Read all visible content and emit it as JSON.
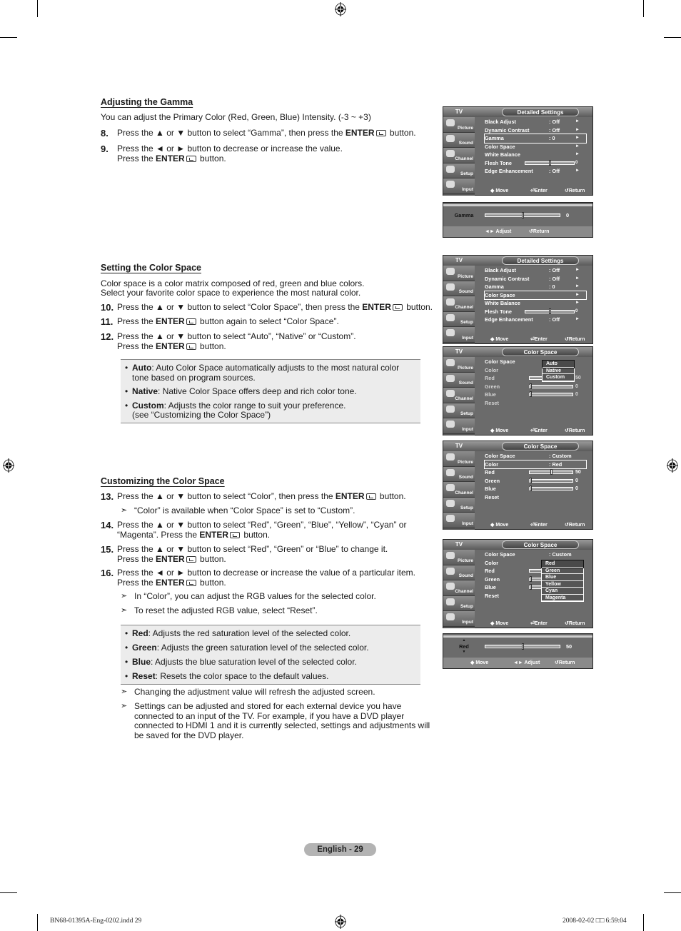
{
  "section_gamma": {
    "heading": "Adjusting the Gamma",
    "intro": "You can adjust the Primary Color (Red, Green, Blue) Intensity. (-3 ~ +3)",
    "steps": [
      {
        "num": "8.",
        "pre": "Press the ▲ or ▼ button to select “Gamma”, then press the ",
        "bold": "ENTER",
        "post": " button."
      },
      {
        "num": "9.",
        "pre": "Press the ◄ or ► button to decrease or increase the value.\nPress the ",
        "bold": "ENTER",
        "post": " button."
      }
    ]
  },
  "section_colorspace": {
    "heading": "Setting the Color Space",
    "intro": "Color space is a color matrix composed of red, green and blue colors.\nSelect your favorite color space to experience the most natural color.",
    "steps": [
      {
        "num": "10.",
        "pre": "Press the ▲ or ▼ button to select “Color Space”, then press the ",
        "bold": "ENTER",
        "post": " button."
      },
      {
        "num": "11.",
        "pre": "Press the ",
        "bold": "ENTER",
        "post": " button again to select “Color Space”."
      },
      {
        "num": "12.",
        "pre": "Press the ▲ or ▼ button to select “Auto”, “Native” or “Custom”.\nPress the ",
        "bold": "ENTER",
        "post": " button."
      }
    ],
    "bullets": [
      {
        "term": "Auto",
        "desc": ": Auto Color Space automatically adjusts to the most natural color\n           tone based on program sources."
      },
      {
        "term": "Native",
        "desc": ": Native Color Space offers deep and rich color tone."
      },
      {
        "term": "Custom",
        "desc": ": Adjusts the color range to suit your preference.\n               (see “Customizing the Color Space”)"
      }
    ]
  },
  "section_custom": {
    "heading": "Customizing the Color Space",
    "steps": [
      {
        "num": "13.",
        "pre": "Press the ▲ or ▼ button to select “Color”, then press the ",
        "bold": "ENTER",
        "post": " button."
      },
      {
        "num": "14.",
        "pre": "Press the ▲ or ▼ button to select “Red”, “Green”, “Blue”, “Yellow”, “Cyan” or\n“Magenta”. Press the ",
        "bold": "ENTER",
        "post": " button."
      },
      {
        "num": "15.",
        "pre": "Press the ▲ or ▼ button to select “Red”, “Green” or “Blue” to change it.\nPress the ",
        "bold": "ENTER",
        "post": " button."
      },
      {
        "num": "16.",
        "pre": "Press the ◄ or ► button to decrease or increase the value of a particular item.\nPress the ",
        "bold": "ENTER",
        "post": " button."
      }
    ],
    "note_13": "“Color” is available when “Color Space” is set to “Custom”.",
    "notes_16": [
      "In “Color”, you can adjust the RGB values for the selected color.",
      "To reset the adjusted RGB value, select “Reset”."
    ],
    "bullets": [
      {
        "term": "Red",
        "desc": ": Adjusts the red saturation level of the selected color."
      },
      {
        "term": "Green",
        "desc": ": Adjusts the green saturation level of the selected color."
      },
      {
        "term": "Blue",
        "desc": ": Adjusts the blue saturation level of the selected color."
      },
      {
        "term": "Reset",
        "desc": ": Resets the color space to the default values."
      }
    ],
    "final_notes": [
      "Changing the adjustment value will refresh the adjusted screen.",
      "Settings can be adjusted and stored for each external device you have\nconnected to an input of the TV. For example, if you have a DVD player\nconnected to HDMI 1 and it is currently selected, settings and adjustments will\nbe saved for the DVD player."
    ]
  },
  "osd": {
    "tv_label": "TV",
    "categories": [
      "Picture",
      "Sound",
      "Channel",
      "Setup",
      "Input"
    ],
    "footer": {
      "move": "◆ Move",
      "enter": "⏎Enter",
      "return": "↺Return",
      "adjust": "◄► Adjust"
    },
    "detailed": {
      "title": "Detailed Settings",
      "rows": [
        {
          "k": "Black Adjust",
          "v": ": Off",
          "ar": "►"
        },
        {
          "k": "Dynamic Contrast",
          "v": ": Off",
          "ar": "►"
        },
        {
          "k": "Gamma",
          "v": ": 0",
          "ar": "►"
        },
        {
          "k": "Color Space",
          "v": "",
          "ar": "►"
        },
        {
          "k": "White Balance",
          "v": "",
          "ar": "►"
        },
        {
          "k": "Flesh Tone",
          "v": "",
          "ar": "0"
        },
        {
          "k": "Edge Enhancement",
          "v": ": Off",
          "ar": "►"
        }
      ],
      "flesh_tone_value": 0
    },
    "gamma_adjust": {
      "label": "Gamma",
      "value": "0",
      "fraction": 0.5
    },
    "colorspace": {
      "title": "Color Space",
      "rows": [
        "Color Space",
        "Color",
        "Red",
        "Green",
        "Blue",
        "Reset"
      ],
      "custom_value": ": Custom",
      "color_value": ": Red",
      "red": "50",
      "green": "0",
      "blue": "0",
      "space_options": [
        "Auto",
        "Native",
        "Custom"
      ],
      "color_options": [
        "Red",
        "Green",
        "Blue",
        "Yellow",
        "Cyan",
        "Magenta"
      ]
    },
    "red_adjust": {
      "label": "Red",
      "value": "50",
      "fraction": 0.5
    }
  },
  "footer": {
    "page_label": "English - 29",
    "slug_left": "BN68-01395A-Eng-0202.indd   29",
    "slug_right": "2008-02-02   □□ 6:59:04"
  }
}
